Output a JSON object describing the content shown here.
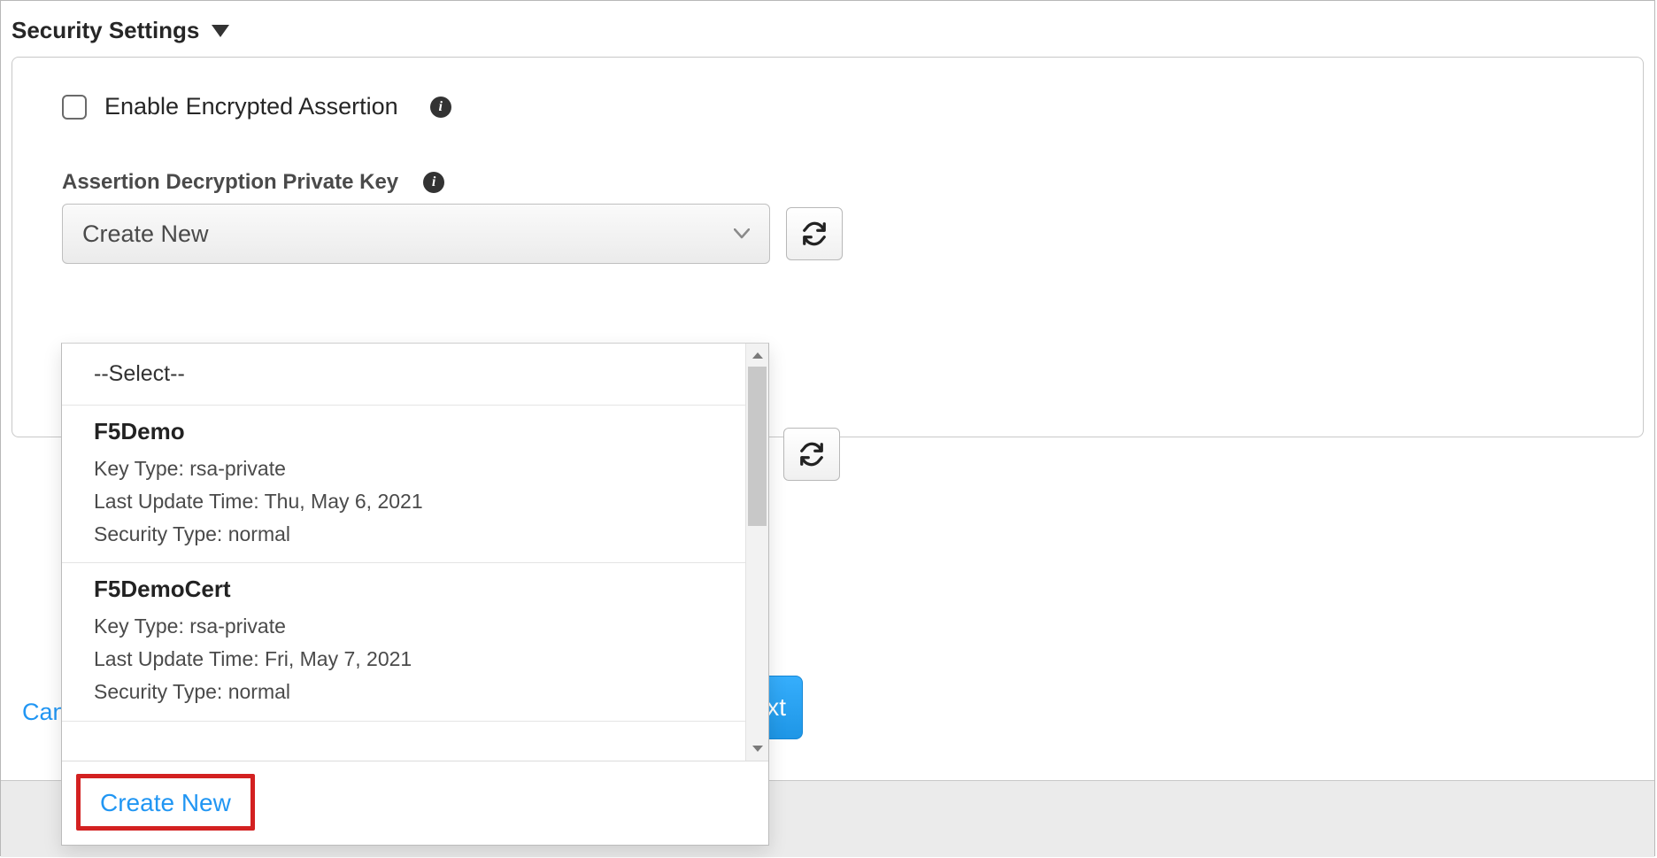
{
  "section": {
    "title": "Security Settings"
  },
  "checkbox": {
    "label": "Enable Encrypted Assertion"
  },
  "field": {
    "label": "Assertion Decryption Private Key",
    "selected": "Create New"
  },
  "dropdown": {
    "placeholder": "--Select--",
    "items": [
      {
        "name": "F5Demo",
        "keyType": "Key Type: rsa-private",
        "lastUpdate": "Last Update Time: Thu, May 6, 2021",
        "securityType": "Security Type: normal"
      },
      {
        "name": "F5DemoCert",
        "keyType": "Key Type: rsa-private",
        "lastUpdate": "Last Update Time: Fri, May 7, 2021",
        "securityType": "Security Type: normal"
      }
    ],
    "createNew": "Create New"
  },
  "footer": {
    "cancel": "Cancel",
    "next": "Save & Next",
    "nextVisible": "xt"
  }
}
